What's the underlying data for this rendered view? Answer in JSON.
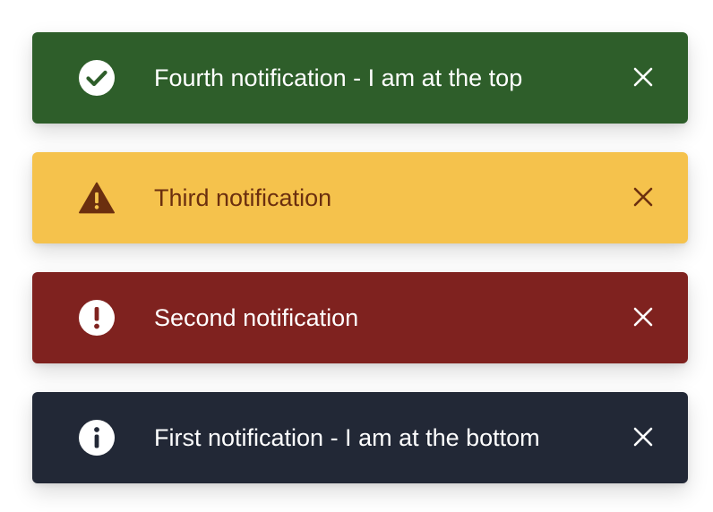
{
  "notifications": [
    {
      "message": "Fourth notification - I am at the top",
      "type": "success",
      "icon": "check-circle-icon",
      "background": "#2e5e2a",
      "text_color": "#ffffff",
      "close_icon": "close-icon"
    },
    {
      "message": "Third notification",
      "type": "warning",
      "icon": "warning-triangle-icon",
      "background": "#f5c24c",
      "text_color": "#6b2f0f",
      "close_icon": "close-icon"
    },
    {
      "message": "Second notification",
      "type": "error",
      "icon": "exclamation-circle-icon",
      "background": "#7f221f",
      "text_color": "#ffffff",
      "close_icon": "close-icon"
    },
    {
      "message": "First notification - I am at the bottom",
      "type": "info",
      "icon": "info-circle-icon",
      "background": "#222836",
      "text_color": "#ffffff",
      "close_icon": "close-icon"
    }
  ]
}
